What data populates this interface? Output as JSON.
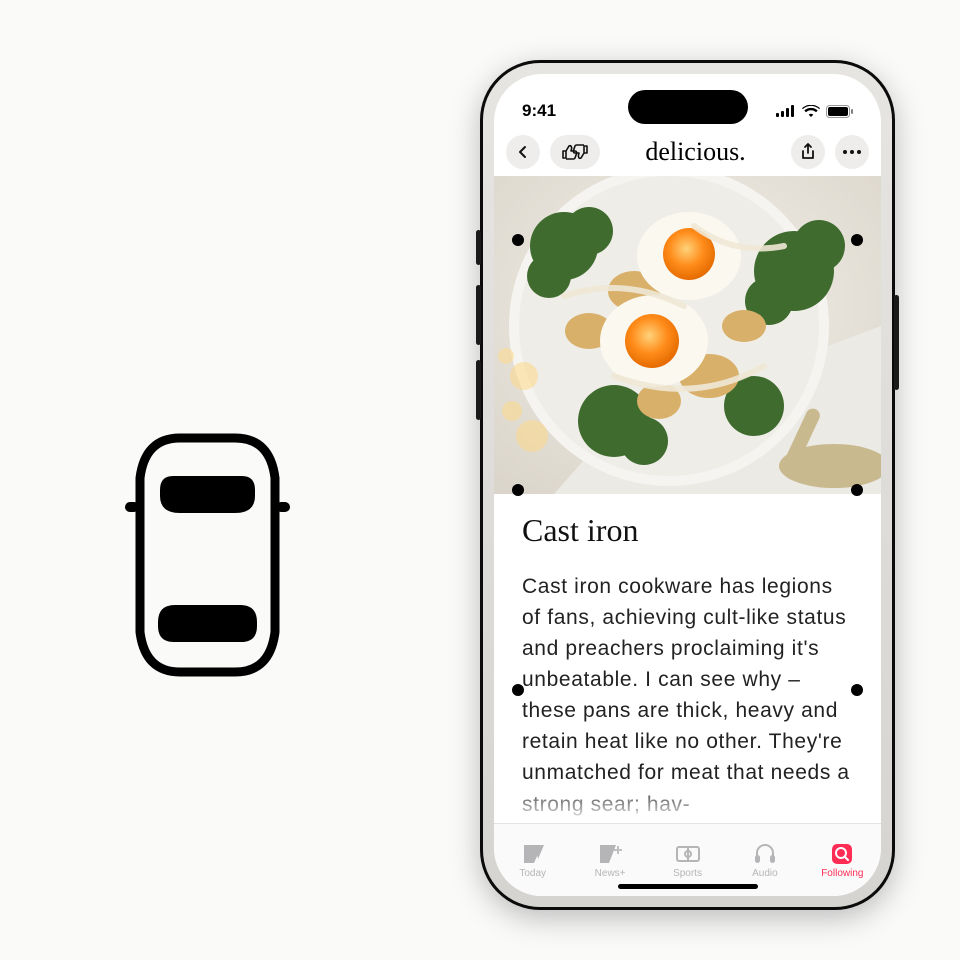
{
  "status": {
    "time": "9:41"
  },
  "nav": {
    "title": "delicious."
  },
  "article": {
    "heading": "Cast iron",
    "body": "Cast iron cookware has legions of fans, achieving cult-like status and preachers proclaiming it's unbeatable. I can see why – these pans are thick, heavy and retain heat like no other. They're unmatched for meat that needs a strong sear; hav-"
  },
  "tabs": [
    {
      "label": "Today"
    },
    {
      "label": "News+"
    },
    {
      "label": "Sports"
    },
    {
      "label": "Audio"
    },
    {
      "label": "Following"
    }
  ],
  "active_tab_index": 4
}
